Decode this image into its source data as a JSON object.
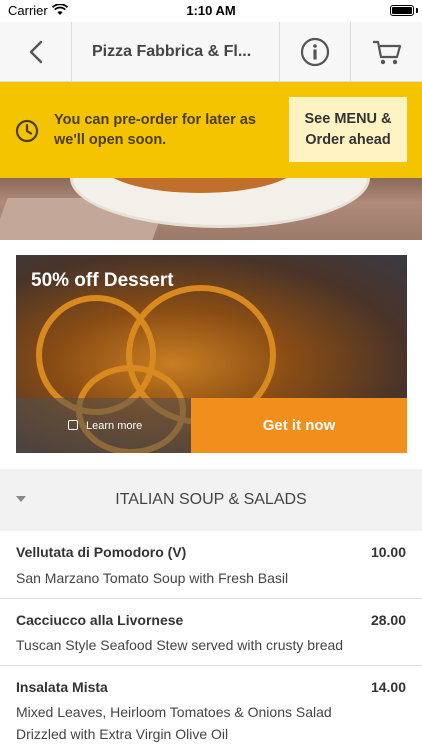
{
  "status_bar": {
    "carrier": "Carrier",
    "time": "1:10 AM"
  },
  "nav": {
    "title": "Pizza Fabbrica & Fl...",
    "back_icon": "chevron-left-icon",
    "info_icon": "info-icon",
    "cart_icon": "cart-icon"
  },
  "preorder": {
    "message": "You can pre-order for later as we'll open soon.",
    "button_label": "See MENU & Order ahead",
    "icon": "clock-icon"
  },
  "promo": {
    "title": "50% off Dessert",
    "learn_more": "Learn more",
    "cta": "Get it now"
  },
  "section": {
    "title": "ITALIAN SOUP & SALADS"
  },
  "menu_items": [
    {
      "name": "Vellutata di Pomodoro (V)",
      "price": "10.00",
      "description": "San Marzano Tomato Soup with Fresh Basil"
    },
    {
      "name": "Cacciucco alla Livornese",
      "price": "28.00",
      "description": "Tuscan Style Seafood Stew served with crusty bread"
    },
    {
      "name": "Insalata Mista",
      "price": "14.00",
      "description": "Mixed Leaves, Heirloom Tomatoes & Onions Salad Drizzled with Extra Virgin Olive Oil"
    }
  ],
  "colors": {
    "brand_yellow": "#f5c400",
    "cta_orange": "#f18e1c",
    "preorder_button_bg": "#fff3c4"
  }
}
